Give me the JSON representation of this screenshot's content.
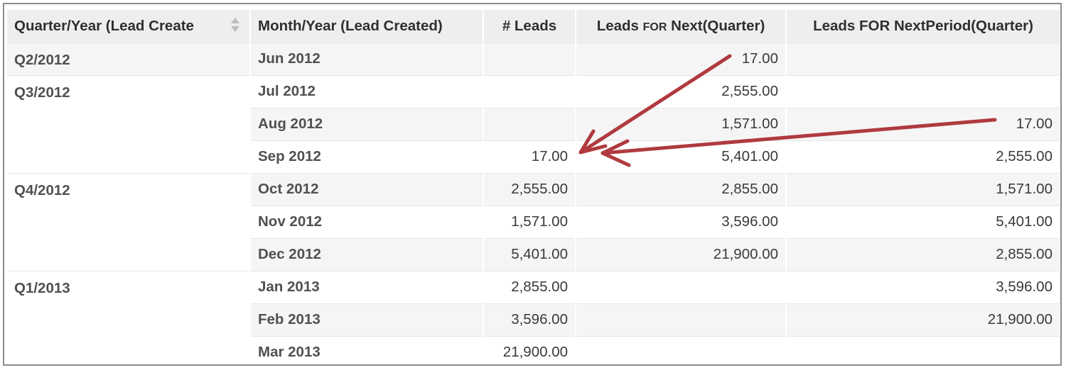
{
  "columns": [
    "Quarter/Year (Lead Created)",
    "Month/Year (Lead Created)",
    "# Leads",
    "Leads FOR Next(Quarter)",
    "Leads FOR NextPeriod(Quarter)"
  ],
  "header": {
    "col0": "Quarter/Year (Lead Create",
    "col1": "Month/Year (Lead Created)",
    "col2": "# Leads",
    "col3_pre": "Leads ",
    "col3_for": "FOR",
    "col3_post": " Next(Quarter)",
    "col4": "Leads FOR NextPeriod(Quarter)",
    "sort_icon": "sort-updown-icon"
  },
  "rows": [
    {
      "quarter": "Q2/2012",
      "month": "Jun 2012",
      "leads": "",
      "next": "17.00",
      "next_period": ""
    },
    {
      "quarter": "Q3/2012",
      "month": "Jul 2012",
      "leads": "",
      "next": "2,555.00",
      "next_period": ""
    },
    {
      "quarter": "",
      "month": "Aug 2012",
      "leads": "",
      "next": "1,571.00",
      "next_period": "17.00"
    },
    {
      "quarter": "",
      "month": "Sep 2012",
      "leads": "17.00",
      "next": "5,401.00",
      "next_period": "2,555.00"
    },
    {
      "quarter": "Q4/2012",
      "month": "Oct 2012",
      "leads": "2,555.00",
      "next": "2,855.00",
      "next_period": "1,571.00"
    },
    {
      "quarter": "",
      "month": "Nov 2012",
      "leads": "1,571.00",
      "next": "3,596.00",
      "next_period": "5,401.00"
    },
    {
      "quarter": "",
      "month": "Dec 2012",
      "leads": "5,401.00",
      "next": "21,900.00",
      "next_period": "2,855.00"
    },
    {
      "quarter": "Q1/2013",
      "month": "Jan 2013",
      "leads": "2,855.00",
      "next": "",
      "next_period": "3,596.00"
    },
    {
      "quarter": "",
      "month": "Feb 2013",
      "leads": "3,596.00",
      "next": "",
      "next_period": "21,900.00"
    },
    {
      "quarter": "",
      "month": "Mar 2013",
      "leads": "21,900.00",
      "next": "",
      "next_period": ""
    }
  ],
  "quarter_groups": [
    {
      "label": "Q2/2012",
      "rowspan": 1
    },
    {
      "label": "Q3/2012",
      "rowspan": 3
    },
    {
      "label": "Q4/2012",
      "rowspan": 3
    },
    {
      "label": "Q1/2013",
      "rowspan": 3
    }
  ],
  "annotations": {
    "arrow_color": "#b03a3e"
  },
  "colors": {
    "header_bg": "#eeeeee",
    "stripe_bg": "#f5f5f5",
    "border": "#8c8c8c"
  }
}
